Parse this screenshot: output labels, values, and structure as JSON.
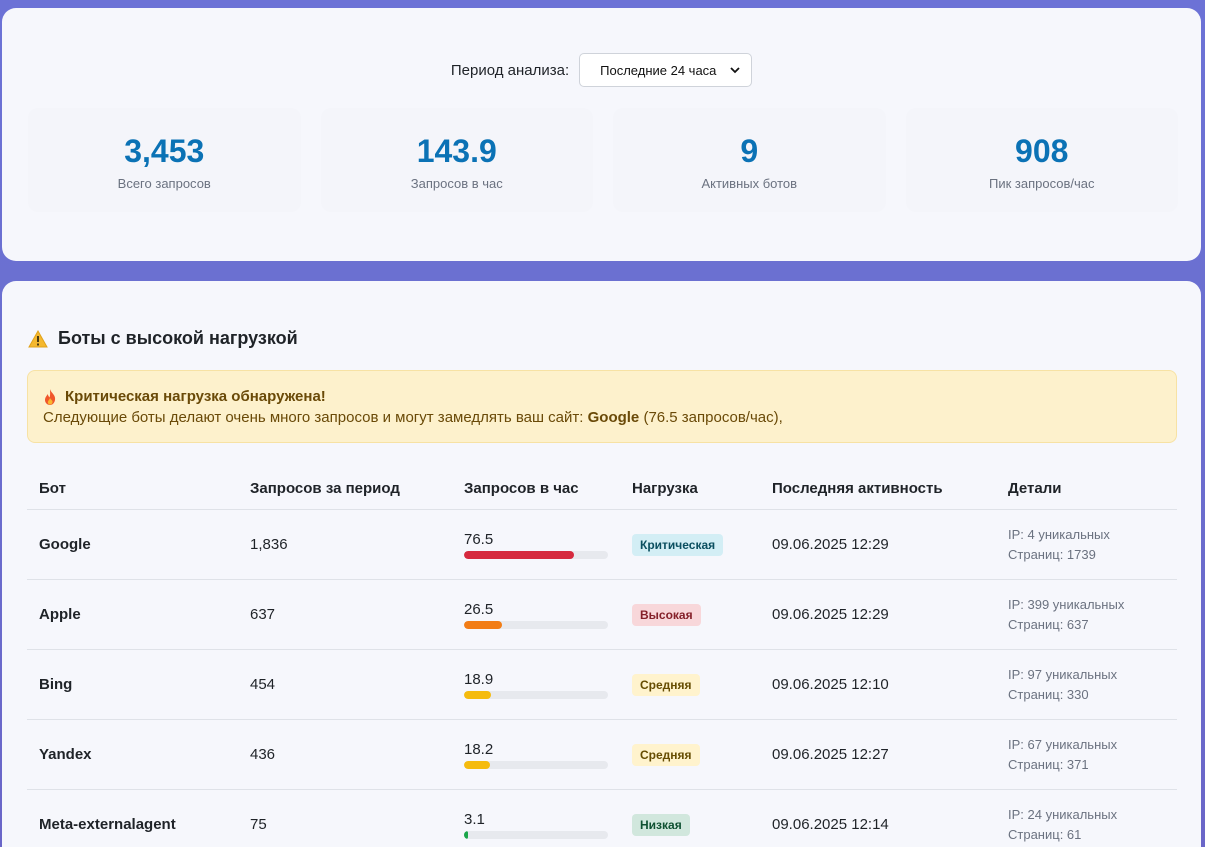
{
  "filter": {
    "label": "Период анализа:",
    "selected": "Последние 24 часа"
  },
  "stats": [
    {
      "value": "3,453",
      "label": "Всего запросов"
    },
    {
      "value": "143.9",
      "label": "Запросов в час"
    },
    {
      "value": "9",
      "label": "Активных ботов"
    },
    {
      "value": "908",
      "label": "Пик запросов/час"
    }
  ],
  "section": {
    "title": "Боты с высокой нагрузкой",
    "icon": "warning-icon"
  },
  "alert": {
    "title": "Критическая нагрузка обнаружена!",
    "text_prefix": "Следующие боты делают очень много запросов и могут замедлять ваш сайт: ",
    "bot": "Google",
    "text_suffix": " (76.5 запросов/час),",
    "icon": "fire-icon"
  },
  "table": {
    "headers": [
      "Бот",
      "Запросов за период",
      "Запросов в час",
      "Нагрузка",
      "Последняя активность",
      "Детали"
    ],
    "rows": [
      {
        "bot": "Google",
        "requests": "1,836",
        "rate": "76.5",
        "fill": 0.765,
        "bar_color": "#d6293e",
        "load": "Критическая",
        "badge_bg": "#d3eef5",
        "badge_fg": "#0b4f60",
        "last": "09.06.2025 12:29",
        "ip": "IP: 4 уникальных",
        "pages": "Страниц: 1739"
      },
      {
        "bot": "Apple",
        "requests": "637",
        "rate": "26.5",
        "fill": 0.265,
        "bar_color": "#f27d16",
        "load": "Высокая",
        "badge_bg": "#f8d7da",
        "badge_fg": "#842029",
        "last": "09.06.2025 12:29",
        "ip": "IP: 399 уникальных",
        "pages": "Страниц: 637"
      },
      {
        "bot": "Bing",
        "requests": "454",
        "rate": "18.9",
        "fill": 0.189,
        "bar_color": "#f5bb0e",
        "load": "Средняя",
        "badge_bg": "#fff3cd",
        "badge_fg": "#664d03",
        "last": "09.06.2025 12:10",
        "ip": "IP: 97 уникальных",
        "pages": "Страниц: 330"
      },
      {
        "bot": "Yandex",
        "requests": "436",
        "rate": "18.2",
        "fill": 0.182,
        "bar_color": "#f5bb0e",
        "load": "Средняя",
        "badge_bg": "#fff3cd",
        "badge_fg": "#664d03",
        "last": "09.06.2025 12:27",
        "ip": "IP: 67 уникальных",
        "pages": "Страниц: 371"
      },
      {
        "bot": "Meta-externalagent",
        "requests": "75",
        "rate": "3.1",
        "fill": 0.031,
        "bar_color": "#1aa64a",
        "load": "Низкая",
        "badge_bg": "#d1e7dd",
        "badge_fg": "#0f5132",
        "last": "09.06.2025 12:14",
        "ip": "IP: 24 уникальных",
        "pages": "Страниц: 61"
      }
    ]
  }
}
